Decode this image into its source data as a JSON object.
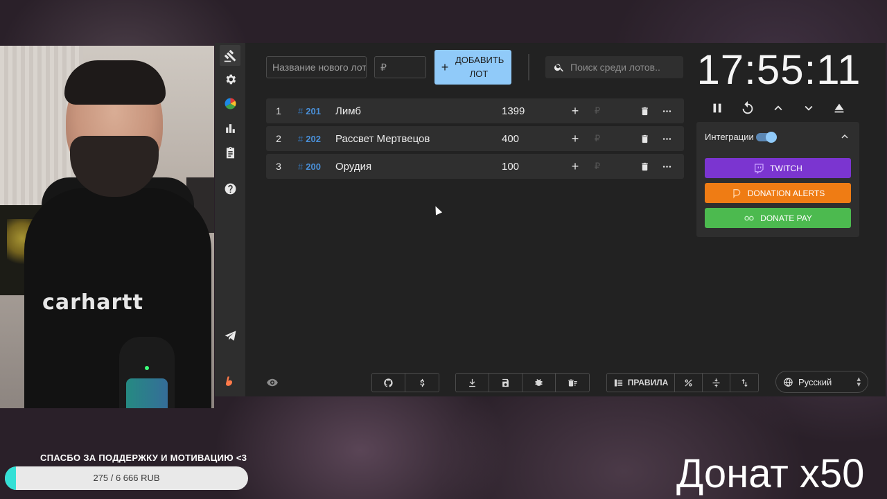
{
  "app": {
    "new_lot_placeholder": "Название нового лота",
    "price_placeholder": "₽",
    "add_button_line1": "ДОБАВИТЬ",
    "add_button_line2": "ЛОТ",
    "search_placeholder": "Поиск среди лотов..",
    "currency_symbol": "₽",
    "lots": [
      {
        "index": "1",
        "id_hash": "#",
        "id": "201",
        "name": "Лимб",
        "amount": "1399"
      },
      {
        "index": "2",
        "id_hash": "#",
        "id": "202",
        "name": "Рассвет Мертвецов",
        "amount": "400"
      },
      {
        "index": "3",
        "id_hash": "#",
        "id": "200",
        "name": "Орудия",
        "amount": "100"
      }
    ]
  },
  "timer": {
    "time": "17:55:11"
  },
  "integrations": {
    "label": "Интеграции",
    "enabled": true,
    "twitch": {
      "label": "TWITCH",
      "color": "#7b35d0"
    },
    "donation_alerts": {
      "label": "DONATION ALERTS",
      "color": "#ef7c14"
    },
    "donate_pay": {
      "label": "DONATE PAY",
      "color": "#4cba4f"
    }
  },
  "toolbar": {
    "rules_label": "ПРАВИЛА",
    "language": "Русский"
  },
  "stream": {
    "thanks_text": "СПАСБО ЗА ПОДДЕРЖКУ И МОТИВАЦИЮ <3",
    "goal_text": "275 / 6 666 RUB",
    "goal_progress": 0.0413,
    "donat_text": "Донат x50",
    "webcam_shirt_text": "carhartt"
  },
  "colors": {
    "accent": "#90caf9",
    "lot_id": "#4a90d9",
    "panel_bg": "#222222"
  }
}
